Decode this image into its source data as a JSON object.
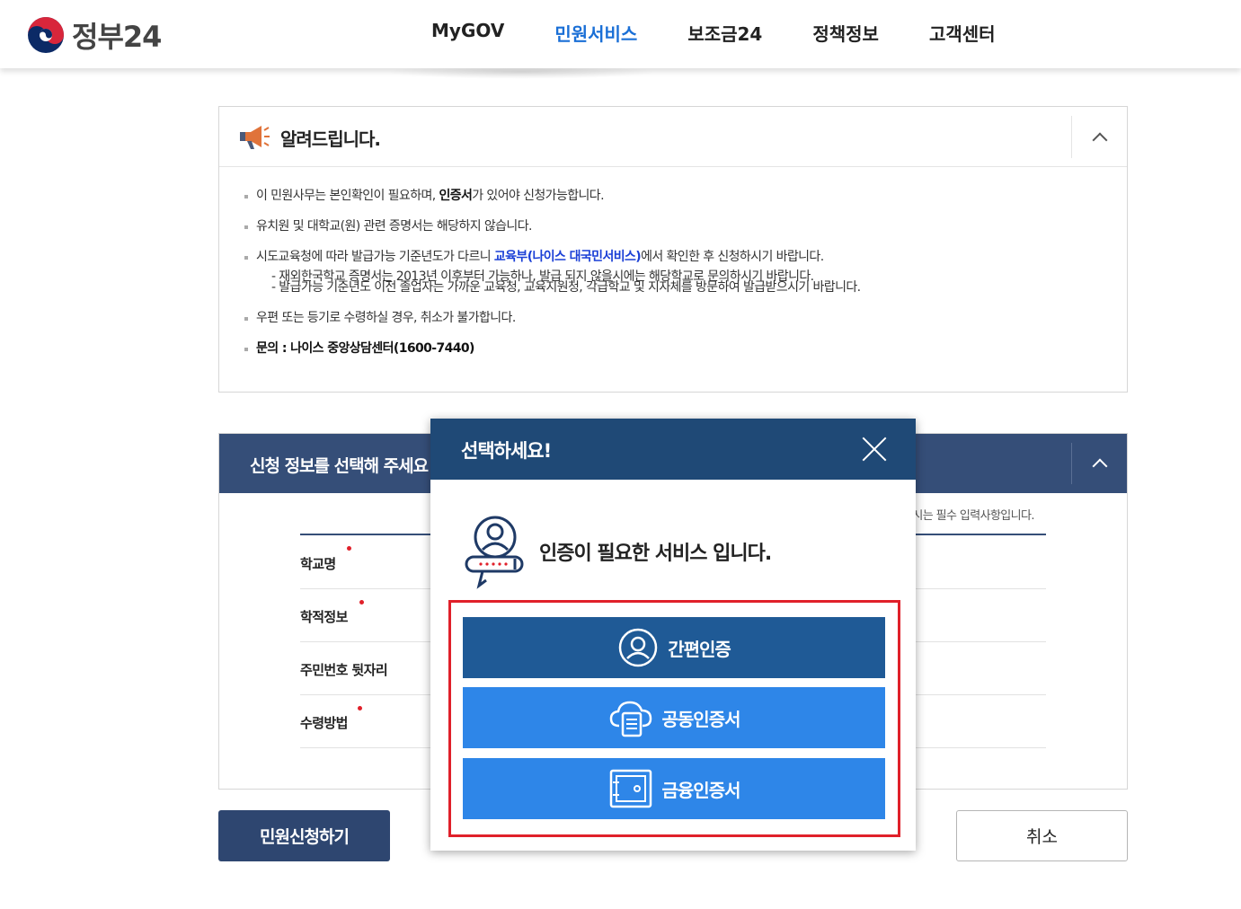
{
  "header": {
    "logo_text": "정부24",
    "nav": [
      "MyGOV",
      "민원서비스",
      "보조금24",
      "정책정보",
      "고객센터"
    ],
    "active_nav": "민원서비스"
  },
  "notice": {
    "title": "알려드립니다.",
    "line1_pre": "이 민원사무는 본인확인이 필요하며, ",
    "line1_bold": "인증서",
    "line1_post": "가 있어야 신청가능합니다.",
    "line2": "유치원 및 대학교(원) 관련 증명서는 해당하지 않습니다.",
    "line3_pre": "시도교육청에 따라 발급가능 기준년도가 다르니 ",
    "line3_link": "교육부(나이스 대국민서비스)",
    "line3_post": "에서 확인한 후 신청하시기 바랍니다.",
    "sub1": "- 재외한국학교 증명서는 2013년 이후부터 가능하나, 발급 되지 않을시에는 해당학교로 문의하시기 바랍니다.",
    "sub2": "- 발급가능 기준년도 이전 졸업자는 가까운 교육청, 교육지원청, 각급학교 및 지자체를 방문하여 발급받으시기 바랍니다.",
    "line4": "우편 또는 등기로 수령하실 경우, 취소가 불가합니다.",
    "line5": "문의 : 나이스 중앙상담센터(1600-7440)"
  },
  "apply": {
    "title": "신청 정보를 선택해 주세요",
    "required_note": "표시는 필수 입력사항입니다.",
    "fields": [
      "학교명",
      "학적정보",
      "주민번호 뒷자리",
      "수령방법"
    ]
  },
  "buttons": {
    "apply": "민원신청하기",
    "cancel": "취소"
  },
  "modal": {
    "title": "선택하세요!",
    "message": "인증이 필요한 서비스 입니다.",
    "options": {
      "simple": "간편인증",
      "joint": "공동인증서",
      "finance": "금융인증서"
    }
  }
}
